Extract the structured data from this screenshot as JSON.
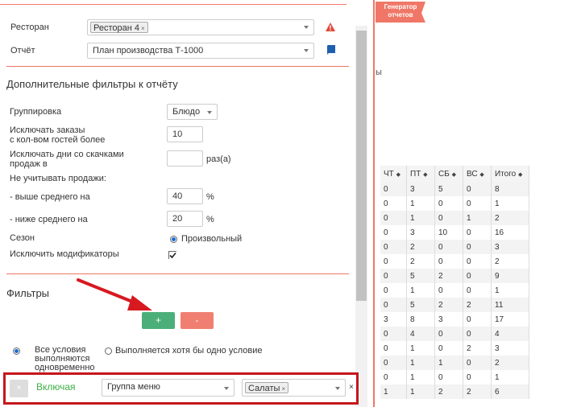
{
  "background": {
    "report_tab": "Генератор отчетов",
    "partial_label": "ы",
    "table": {
      "headers": [
        "ЧТ",
        "ПТ",
        "СБ",
        "ВС",
        "Итого"
      ],
      "rows": [
        [
          "0",
          "3",
          "5",
          "0",
          "8"
        ],
        [
          "0",
          "1",
          "0",
          "0",
          "1"
        ],
        [
          "0",
          "1",
          "0",
          "1",
          "2"
        ],
        [
          "0",
          "3",
          "10",
          "0",
          "16"
        ],
        [
          "0",
          "2",
          "0",
          "0",
          "3"
        ],
        [
          "0",
          "2",
          "0",
          "0",
          "2"
        ],
        [
          "0",
          "5",
          "2",
          "0",
          "9"
        ],
        [
          "0",
          "1",
          "0",
          "0",
          "1"
        ],
        [
          "0",
          "5",
          "2",
          "2",
          "11"
        ],
        [
          "3",
          "8",
          "3",
          "0",
          "17"
        ],
        [
          "0",
          "4",
          "0",
          "0",
          "4"
        ],
        [
          "0",
          "1",
          "0",
          "2",
          "3"
        ],
        [
          "0",
          "1",
          "1",
          "0",
          "2"
        ],
        [
          "0",
          "1",
          "0",
          "0",
          "1"
        ],
        [
          "1",
          "1",
          "2",
          "2",
          "6"
        ]
      ]
    }
  },
  "form": {
    "restaurant_label": "Ресторан",
    "restaurant_tag": "Ресторан 4",
    "tag_remove": "×",
    "report_label": "Отчёт",
    "report_value": "План производства Т-1000",
    "extra_filters_title": "Дополнительные фильтры к отчёту",
    "grouping_label": "Группировка",
    "grouping_value": "Блюдо",
    "exclude_guests_label_1": "Исключать заказы",
    "exclude_guests_label_2": "с кол-вом гостей более",
    "exclude_guests_value": "10",
    "exclude_days_label_1": "Исключать дни со скачками",
    "exclude_days_label_2": "продаж в",
    "exclude_days_value": "",
    "exclude_days_unit": "раз(а)",
    "ignore_sales_label": "Не учитывать продажи:",
    "above_avg_label": "- выше среднего на",
    "above_avg_value": "40",
    "below_avg_label": "- ниже среднего на",
    "below_avg_value": "20",
    "percent": "%",
    "season_label": "Сезон",
    "season_value": "Произвольный",
    "exclude_modifiers_label": "Исключить модификаторы",
    "exclude_modifiers_checked": true
  },
  "filters": {
    "title": "Фильтры",
    "add_label": "+",
    "remove_label": "-",
    "all_conditions_1": "Все условия",
    "all_conditions_2": "выполняются",
    "all_conditions_3": "одновременно",
    "any_condition": "Выполняется хотя бы одно условие",
    "row": {
      "remove_label": "×",
      "mode": "Включая",
      "field": "Группа меню",
      "value_tag": "Салаты",
      "clear": "×"
    }
  },
  "colors": {
    "accent": "#f07767",
    "add_button": "#4caf7a",
    "remove_button": "#f07f72",
    "include_text": "#3cb043",
    "highlight": "#c4161c",
    "arrow": "#d71920"
  }
}
